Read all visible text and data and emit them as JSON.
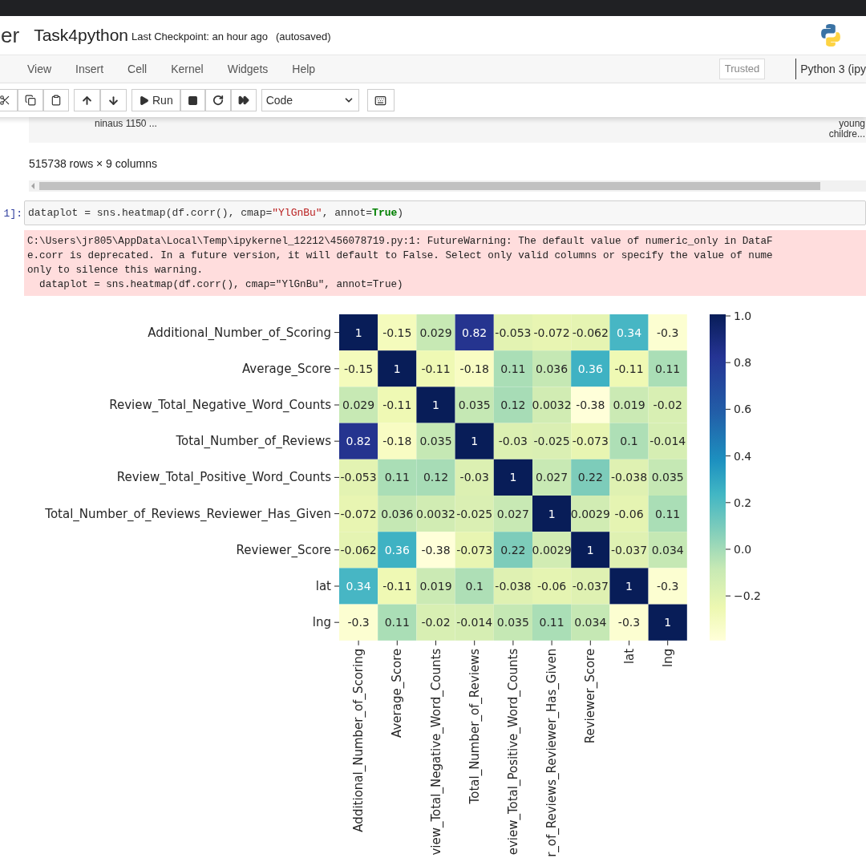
{
  "header": {
    "app_name": "er",
    "notebook_title": "Task4python",
    "checkpoint": "Last Checkpoint: an hour ago",
    "autosave": "(autosaved)"
  },
  "menu": [
    "View",
    "Insert",
    "Cell",
    "Kernel",
    "Widgets",
    "Help"
  ],
  "trusted": "Trusted",
  "kernel": "Python 3 (ipy",
  "toolbar": {
    "run_label": "Run",
    "cell_type": "Code"
  },
  "output_preview": {
    "left_text": "ninaus 1150 ...",
    "right_lines": [
      "young",
      "childre..."
    ]
  },
  "dataframe_shape": "515738 rows × 9 columns",
  "code_cell": {
    "prompt": "1]:",
    "tokens": [
      {
        "kind": "plain",
        "text": "dataplot = sns.heatmap(df.corr(), cmap="
      },
      {
        "kind": "string",
        "text": "\"YlGnBu\""
      },
      {
        "kind": "plain",
        "text": ", annot="
      },
      {
        "kind": "keyword",
        "text": "True"
      },
      {
        "kind": "plain",
        "text": ")"
      }
    ]
  },
  "warning_lines": [
    "C:\\Users\\jr805\\AppData\\Local\\Temp\\ipykernel_12212\\456078719.py:1: FutureWarning: The default value of numeric_only in DataF",
    "e.corr is deprecated. In a future version, it will default to False. Select only valid columns or specify the value of nume",
    "only to silence this warning.",
    "  dataplot = sns.heatmap(df.corr(), cmap=\"YlGnBu\", annot=True)"
  ],
  "heatmap": {
    "row_labels": [
      "Additional_Number_of_Scoring",
      "Average_Score",
      "Review_Total_Negative_Word_Counts",
      "Total_Number_of_Reviews",
      "Review_Total_Positive_Word_Counts",
      "Total_Number_of_Reviews_Reviewer_Has_Given",
      "Reviewer_Score",
      "lat",
      "lng"
    ],
    "column_labels": [
      "Additional_Number_of_Scoring",
      "Average_Score",
      "view_Total_Negative_Word_Counts",
      "Total_Number_of_Reviews",
      "eview_Total_Positive_Word_Counts",
      "r_of_Reviews_Reviewer_Has_Given",
      "Reviewer_Score",
      "lat",
      "lng"
    ],
    "rows": [
      {
        "cells": [
          {
            "value": "1",
            "color": "#081d58"
          },
          {
            "value": "-0.15",
            "color": "#f4fbbc"
          },
          {
            "value": "0.029",
            "color": "#c7e9b4"
          },
          {
            "value": "0.82",
            "color": "#25348f"
          },
          {
            "value": "-0.053",
            "color": "#e3f3b2"
          },
          {
            "value": "-0.072",
            "color": "#e8f5b2"
          },
          {
            "value": "-0.062",
            "color": "#e5f4b2"
          },
          {
            "value": "0.34",
            "color": "#47b6c4"
          },
          {
            "value": "-0.3",
            "color": "#fcfed1"
          }
        ]
      },
      {
        "cells": [
          {
            "value": "-0.15",
            "color": "#f4fbbc"
          },
          {
            "value": "1",
            "color": "#081d58"
          },
          {
            "value": "-0.11",
            "color": "#eff9b4"
          },
          {
            "value": "-0.18",
            "color": "#f8fcc3"
          },
          {
            "value": "0.11",
            "color": "#aadeb6"
          },
          {
            "value": "0.036",
            "color": "#c5e8b4"
          },
          {
            "value": "0.36",
            "color": "#3fb2c3"
          },
          {
            "value": "-0.11",
            "color": "#eff9b4"
          },
          {
            "value": "0.11",
            "color": "#aadeb6"
          }
        ]
      },
      {
        "cells": [
          {
            "value": "0.029",
            "color": "#c7e9b4"
          },
          {
            "value": "-0.11",
            "color": "#eff9b4"
          },
          {
            "value": "1",
            "color": "#081d58"
          },
          {
            "value": "0.035",
            "color": "#c5e8b4"
          },
          {
            "value": "0.12",
            "color": "#a7dcb6"
          },
          {
            "value": "0.0032",
            "color": "#d1ecb3"
          },
          {
            "value": "-0.38",
            "color": "#ffffd9"
          },
          {
            "value": "0.019",
            "color": "#cbeab4"
          },
          {
            "value": "-0.02",
            "color": "#d8efb3"
          }
        ]
      },
      {
        "cells": [
          {
            "value": "0.82",
            "color": "#25348f"
          },
          {
            "value": "-0.18",
            "color": "#f8fcc3"
          },
          {
            "value": "0.035",
            "color": "#c5e8b4"
          },
          {
            "value": "1",
            "color": "#081d58"
          },
          {
            "value": "-0.03",
            "color": "#dcf0b2"
          },
          {
            "value": "-0.025",
            "color": "#daefb3"
          },
          {
            "value": "-0.073",
            "color": "#e8f5b2"
          },
          {
            "value": "0.1",
            "color": "#aedfb6"
          },
          {
            "value": "-0.014",
            "color": "#d6eeb3"
          }
        ]
      },
      {
        "cells": [
          {
            "value": "-0.053",
            "color": "#e3f3b2"
          },
          {
            "value": "0.11",
            "color": "#aadeb6"
          },
          {
            "value": "0.12",
            "color": "#a7dcb6"
          },
          {
            "value": "-0.03",
            "color": "#dcf0b2"
          },
          {
            "value": "1",
            "color": "#081d58"
          },
          {
            "value": "0.027",
            "color": "#c8e9b4"
          },
          {
            "value": "0.22",
            "color": "#7dccba"
          },
          {
            "value": "-0.038",
            "color": "#dff1b2"
          },
          {
            "value": "0.035",
            "color": "#c5e8b4"
          }
        ]
      },
      {
        "cells": [
          {
            "value": "-0.072",
            "color": "#e8f5b2"
          },
          {
            "value": "0.036",
            "color": "#c5e8b4"
          },
          {
            "value": "0.0032",
            "color": "#d1ecb3"
          },
          {
            "value": "-0.025",
            "color": "#daefb3"
          },
          {
            "value": "0.027",
            "color": "#c8e9b4"
          },
          {
            "value": "1",
            "color": "#081d58"
          },
          {
            "value": "0.0029",
            "color": "#d1ecb3"
          },
          {
            "value": "-0.06",
            "color": "#e5f4b2"
          },
          {
            "value": "0.11",
            "color": "#aadeb6"
          }
        ]
      },
      {
        "cells": [
          {
            "value": "-0.062",
            "color": "#e5f4b2"
          },
          {
            "value": "0.36",
            "color": "#3fb2c3"
          },
          {
            "value": "-0.38",
            "color": "#ffffd9"
          },
          {
            "value": "-0.073",
            "color": "#e8f5b2"
          },
          {
            "value": "0.22",
            "color": "#7dccba"
          },
          {
            "value": "0.0029",
            "color": "#d1ecb3"
          },
          {
            "value": "1",
            "color": "#081d58"
          },
          {
            "value": "-0.037",
            "color": "#dff1b2"
          },
          {
            "value": "0.034",
            "color": "#c5e8b4"
          }
        ]
      },
      {
        "cells": [
          {
            "value": "0.34",
            "color": "#47b6c4"
          },
          {
            "value": "-0.11",
            "color": "#eff9b4"
          },
          {
            "value": "0.019",
            "color": "#cbeab4"
          },
          {
            "value": "0.1",
            "color": "#aedfb6"
          },
          {
            "value": "-0.038",
            "color": "#dff1b2"
          },
          {
            "value": "-0.06",
            "color": "#e5f4b2"
          },
          {
            "value": "-0.037",
            "color": "#dff1b2"
          },
          {
            "value": "1",
            "color": "#081d58"
          },
          {
            "value": "-0.3",
            "color": "#fcfed1"
          }
        ]
      },
      {
        "cells": [
          {
            "value": "-0.3",
            "color": "#fcfed1"
          },
          {
            "value": "0.11",
            "color": "#aadeb6"
          },
          {
            "value": "-0.02",
            "color": "#d8efb3"
          },
          {
            "value": "-0.014",
            "color": "#d6eeb3"
          },
          {
            "value": "0.035",
            "color": "#c5e8b4"
          },
          {
            "value": "0.11",
            "color": "#aadeb6"
          },
          {
            "value": "0.034",
            "color": "#c5e8b4"
          },
          {
            "value": "-0.3",
            "color": "#fcfed1"
          },
          {
            "value": "1",
            "color": "#081d58"
          }
        ]
      }
    ],
    "colorbar_ticks": [
      "1.0",
      "0.8",
      "0.6",
      "0.4",
      "0.2",
      "0.0",
      "−0.2"
    ]
  }
}
